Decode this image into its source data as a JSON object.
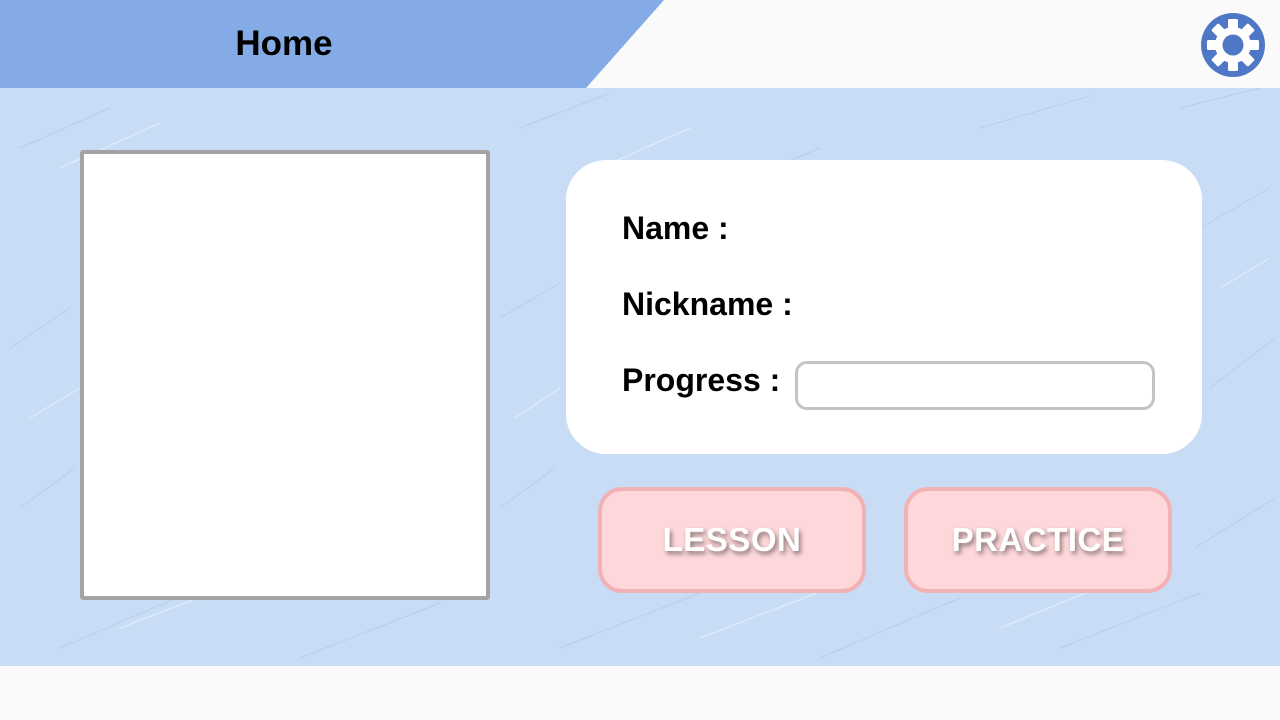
{
  "header": {
    "title": "Home",
    "tab_color": "#84abe6",
    "settings_icon": "gear-icon"
  },
  "profile": {
    "name_label": "Name :",
    "nickname_label": "Nickname :",
    "progress_label": "Progress :",
    "progress_value": 0
  },
  "actions": {
    "lesson_label": "LESSON",
    "practice_label": "PRACTICE",
    "button_color": "#fdd7d9",
    "button_border_color": "#f2b2b5"
  },
  "colors": {
    "background": "#c8ddf5",
    "card": "#ffffff"
  }
}
